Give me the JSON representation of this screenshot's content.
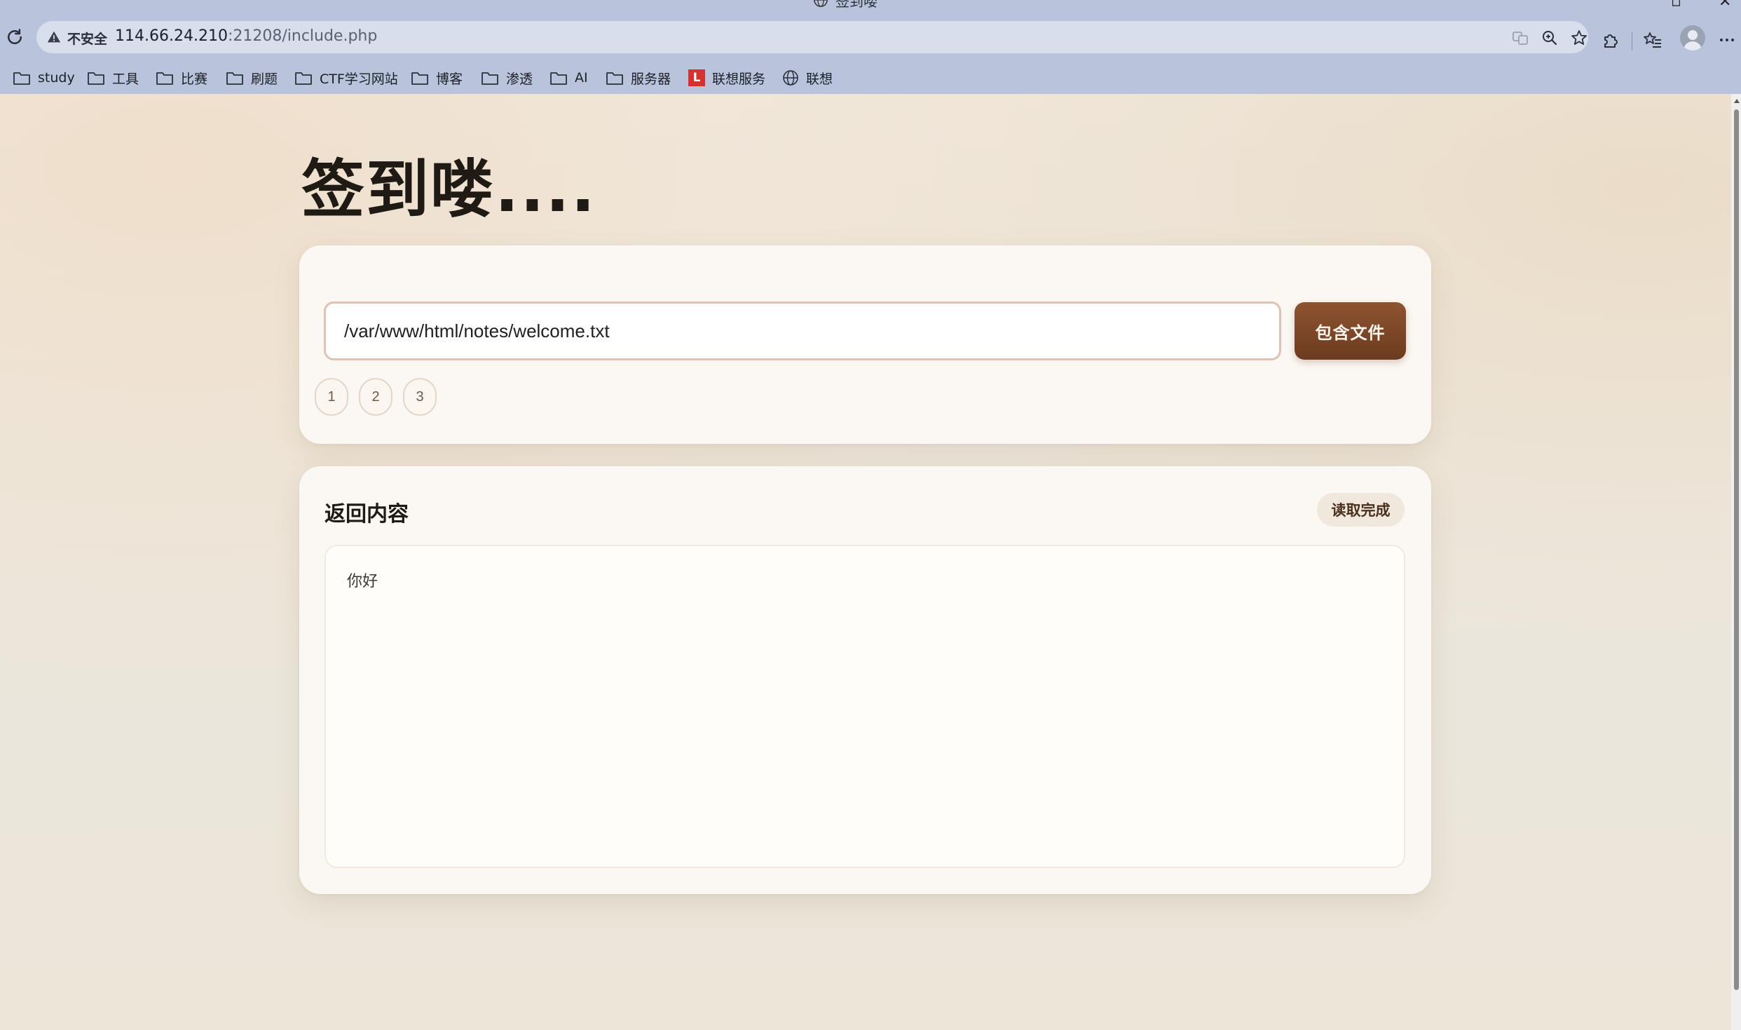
{
  "browser": {
    "tab_title": "签到喽",
    "security_label": "不安全",
    "url_host": "114.66.24.210",
    "url_rest": ":21208/include.php",
    "bookmarks": [
      {
        "label": "study",
        "icon": "folder-icon"
      },
      {
        "label": "工具",
        "icon": "folder-icon"
      },
      {
        "label": "比赛",
        "icon": "folder-icon"
      },
      {
        "label": "刷题",
        "icon": "folder-icon"
      },
      {
        "label": "CTF学习网站",
        "icon": "folder-icon"
      },
      {
        "label": "博客",
        "icon": "folder-icon"
      },
      {
        "label": "渗透",
        "icon": "folder-icon"
      },
      {
        "label": "AI",
        "icon": "folder-icon"
      },
      {
        "label": "服务器",
        "icon": "folder-icon"
      },
      {
        "label": "联想服务",
        "icon": "lenovo-logo-icon",
        "badge_text": "L"
      },
      {
        "label": "联想",
        "icon": "globe-icon"
      }
    ],
    "toolbar_icons": [
      "reload-icon",
      "warning-icon",
      "translate-icon",
      "zoom-icon",
      "star-icon",
      "extensions-icon",
      "favorites-icon",
      "profile-avatar",
      "more-icon"
    ]
  },
  "page": {
    "title": "签到喽....",
    "input": {
      "value": "/var/www/html/notes/welcome.txt",
      "placeholder": ""
    },
    "include_button": "包含文件",
    "presets": [
      "1",
      "2",
      "3"
    ],
    "output": {
      "title": "返回内容",
      "status": "读取完成",
      "content": "你好"
    }
  },
  "colors": {
    "accent": "#7a4526",
    "page_background": "#efe8dd",
    "card_background": "#fbf8f3",
    "browser_chrome": "#b9c4dc"
  }
}
